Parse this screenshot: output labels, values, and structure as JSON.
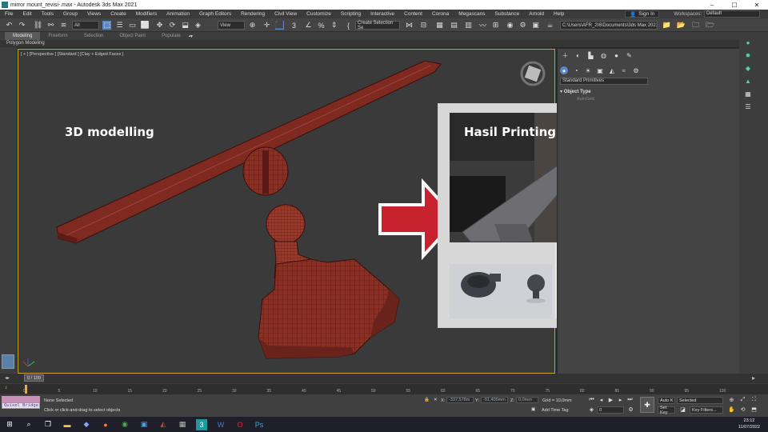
{
  "window": {
    "title": "mirror mount_revisi-.max - Autodesk 3ds Max 2021",
    "controls": [
      "–",
      "☐",
      "✕"
    ]
  },
  "menu": {
    "items": [
      "File",
      "Edit",
      "Tools",
      "Group",
      "Views",
      "Create",
      "Modifiers",
      "Animation",
      "Graph Editors",
      "Rendering",
      "Civil View",
      "Customize",
      "Scripting",
      "Interactive",
      "Content",
      "Corona",
      "Megascans",
      "Substance",
      "Arnold",
      "Help"
    ],
    "sign_in": "Sign In",
    "workspaces_label": "Workspaces:",
    "workspaces_value": "Default"
  },
  "toolbar": {
    "filter_value": "All",
    "view_value": "View",
    "selection_set": "Create Selection Se",
    "project_path": "C:\\Users\\AFR_2\\6\\Documents\\3ds Max 2021"
  },
  "ribbon": {
    "tabs": [
      "Modeling",
      "Freeform",
      "Selection",
      "Object Paint",
      "Populate"
    ],
    "sub_label": "Polygon Modeling"
  },
  "viewport": {
    "label": "[ + ] [Perspective ] [Standard ] [Clay + Edged Faces ]",
    "overlay_left": "3D modelling",
    "overlay_right": "Hasil Printing"
  },
  "command_panel": {
    "primitives_value": "Standard Primitives",
    "object_type": "Object Type",
    "autogrid": "AutoGrid"
  },
  "timeline": {
    "slider": "0 / 100",
    "ticks": [
      "0",
      "5",
      "10",
      "15",
      "20",
      "25",
      "30",
      "35",
      "40",
      "45",
      "50",
      "55",
      "60",
      "65",
      "70",
      "75",
      "80",
      "85",
      "90",
      "95",
      "100"
    ]
  },
  "status": {
    "quixel": "Quixel Bridge",
    "selection": "None Selected",
    "prompt": "Click or click-and-drag to select objects",
    "x_label": "X:",
    "x_value": "-337,578m",
    "y_label": "Y:",
    "y_value": "-51,406mm",
    "z_label": "Z:",
    "z_value": "0,0mm",
    "grid": "Grid = 10,0mm",
    "add_time_tag": "Add Time Tag",
    "auto_key": "Auto K",
    "selected": "Selected",
    "set_key": "Set Key",
    "key_filters": "Key Filters...",
    "frame": "0"
  },
  "taskbar": {
    "time": "23:12",
    "date": "11/07/2022"
  },
  "colors": {
    "accent": "#5c87c9",
    "viewport_border": "#c9a431",
    "model": "#8a2f24",
    "arrow": "#c8222e"
  }
}
